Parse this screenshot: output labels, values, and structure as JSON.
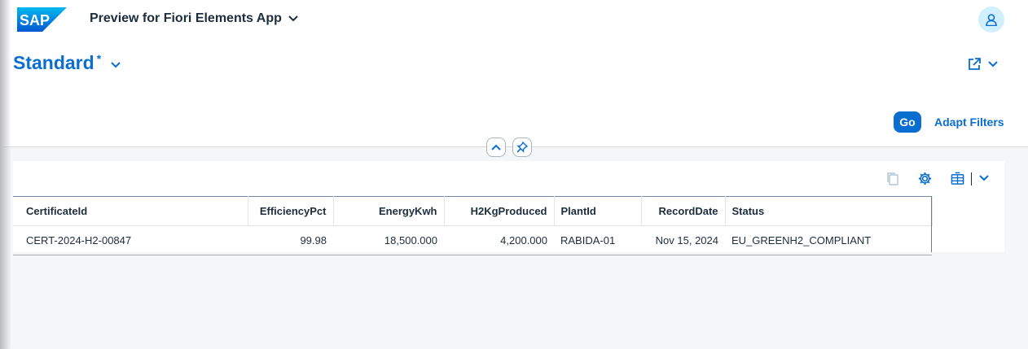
{
  "shell": {
    "logo_text": "SAP",
    "app_title": "Preview for Fiori Elements App"
  },
  "variant": {
    "title": "Standard",
    "modified_marker": "*"
  },
  "filter_bar": {
    "go_label": "Go",
    "adapt_label": "Adapt Filters"
  },
  "table": {
    "columns": [
      "CertificateId",
      "EfficiencyPct",
      "EnergyKwh",
      "H2KgProduced",
      "PlantId",
      "RecordDate",
      "Status"
    ],
    "rows": [
      [
        "CERT-2024-H2-00847",
        "99.98",
        "18,500.000",
        "4,200.000",
        "RABIDA-01",
        "Nov 15, 2024",
        "EU_GREENH2_COMPLIANT"
      ]
    ]
  },
  "colors": {
    "brand": "#0a6ed1",
    "background": "#f5f6f7"
  },
  "icons": [
    "sap-logo",
    "chevron-down-icon",
    "user-icon",
    "share-icon",
    "collapse-icon",
    "pin-icon",
    "copy-icon",
    "settings-icon",
    "export-icon"
  ]
}
